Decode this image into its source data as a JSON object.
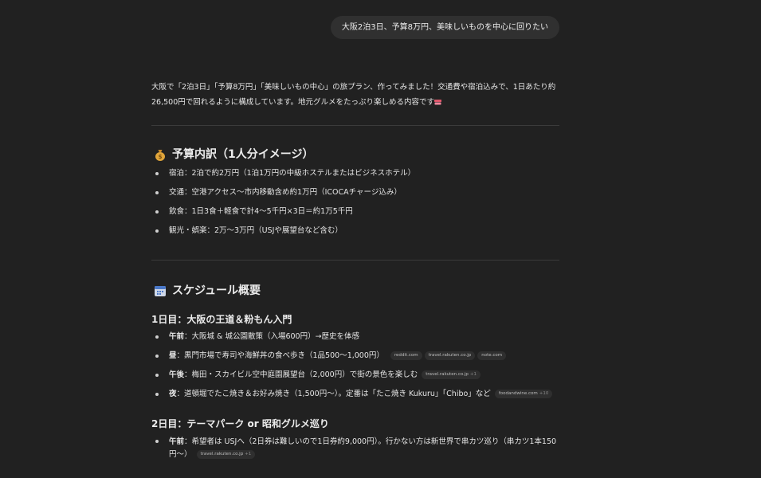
{
  "user_message": "大阪2泊3日、予算8万円、美味しいものを中心に回りたい",
  "intro": "大阪で「2泊3日」「予算8万円」「美味しいもの中心」の旅プラン、作ってみました！交通費や宿泊込みで、1日あたり約26,500円で回れるように構成しています。地元グルメをたっぷり楽しめる内容です",
  "budget": {
    "title": "予算内訳（1人分イメージ）",
    "items": [
      "宿泊：2泊で約2万円（1泊1万円の中級ホステルまたはビジネスホテル）",
      "交通：空港アクセス〜市内移動含め約1万円（ICOCAチャージ込み）",
      "飲食：1日3食＋軽食で計4〜5千円×3日＝約1万5千円",
      "観光・娯楽：2万〜3万円（USJや展望台など含む）"
    ]
  },
  "schedule": {
    "title": "スケジュール概要",
    "day1": {
      "title": "1日目：大阪の王道＆粉もん入門",
      "items": [
        {
          "label": "午前",
          "text": "：大阪城 & 城公園散策（入場600円）→歴史を体感"
        },
        {
          "label": "昼",
          "text": "：黒門市場で寿司や海鮮丼の食べ歩き（1品500〜1,000円）",
          "chips": [
            {
              "text": "reddit.com"
            },
            {
              "text": "travel.rakuten.co.jp"
            },
            {
              "text": "note.com"
            }
          ]
        },
        {
          "label": "午後",
          "text": "：梅田・スカイビル空中庭園展望台（2,000円）で街の景色を楽しむ",
          "chips": [
            {
              "text": "travel.rakuten.co.jp",
              "more": "+1"
            }
          ]
        },
        {
          "label": "夜",
          "text": "：道頓堀でたこ焼き＆お好み焼き（1,500円〜）。定番は「たこ焼き Kukuru」「Chibo」など",
          "chips": [
            {
              "text": "foodandwine.com",
              "more": "+10"
            }
          ]
        }
      ]
    },
    "day2": {
      "title": "2日目：テーマパーク or 昭和グルメ巡り",
      "items": [
        {
          "label": "午前",
          "text": "：希望者は USJへ（2日券は難しいので1日券約9,000円）。行かない方は新世界で串カツ巡り（串カツ1本150円〜）",
          "chips": [
            {
              "text": "travel.rakuten.co.jp",
              "more": "+1"
            }
          ]
        }
      ]
    }
  }
}
